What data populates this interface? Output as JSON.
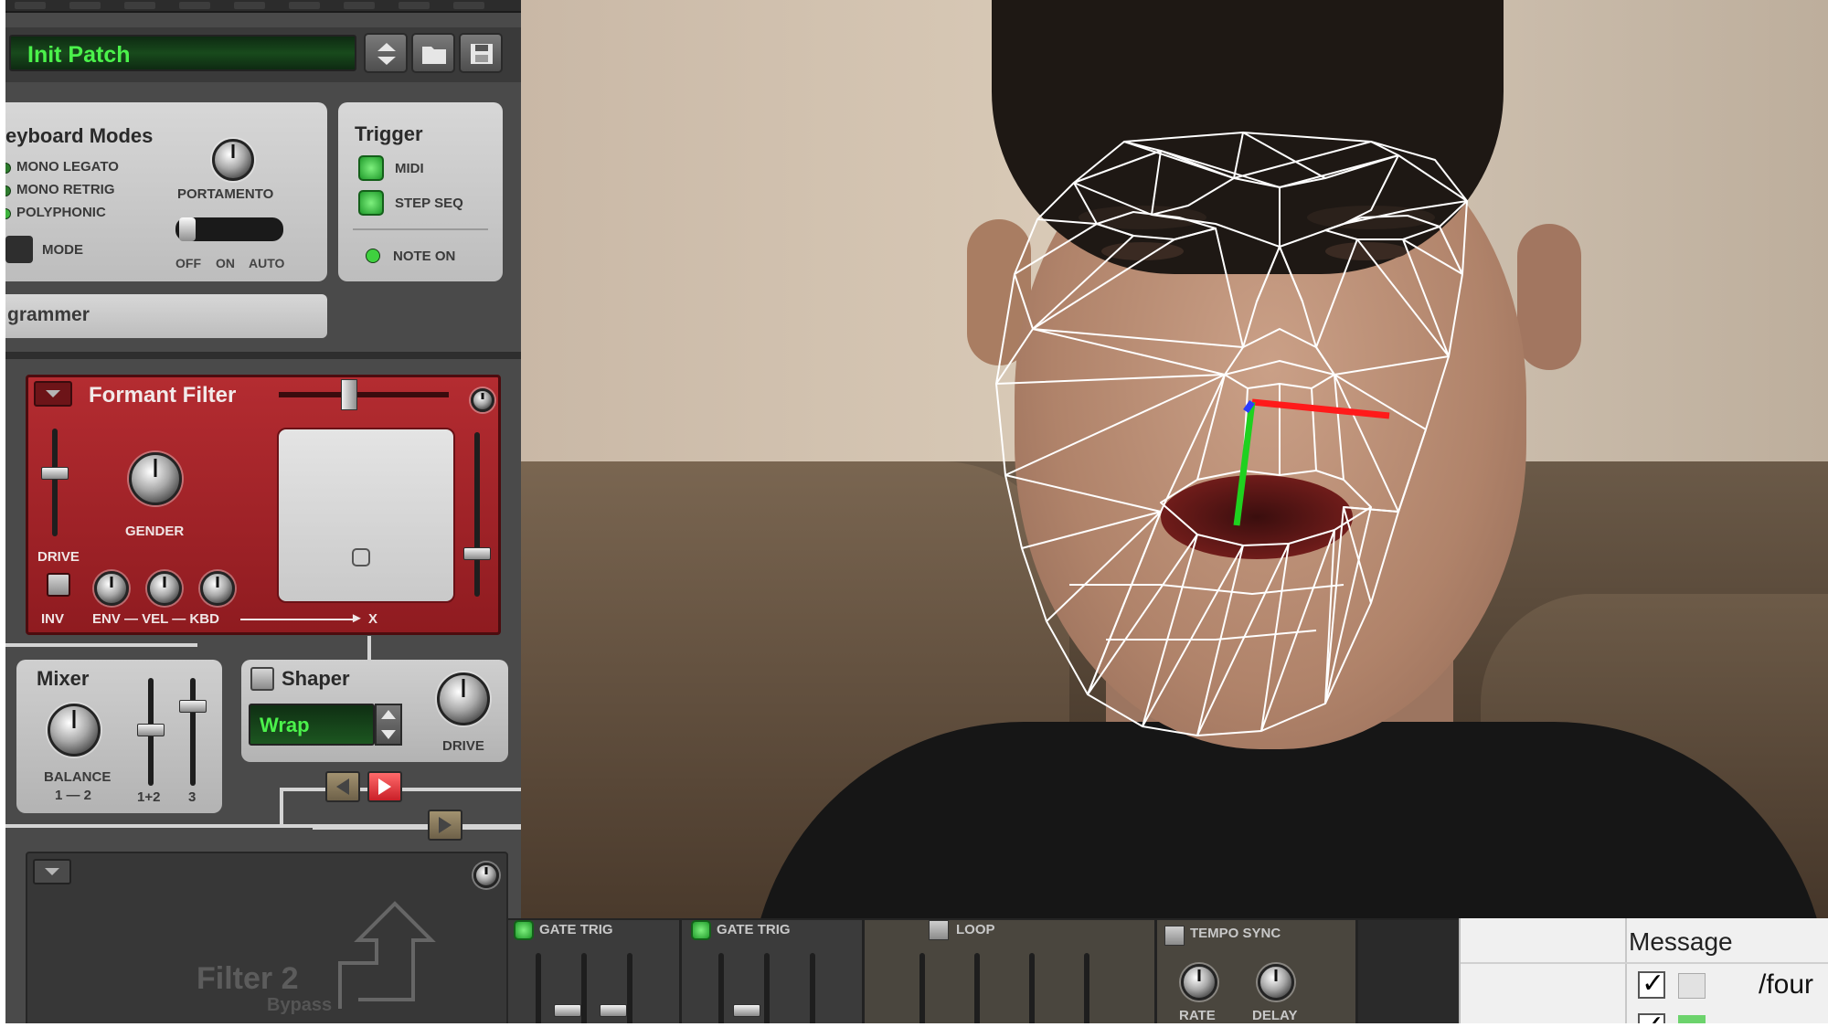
{
  "rack": {
    "patch_name": "Init Patch",
    "keyboard_modes": {
      "title": "eyboard Modes",
      "options": [
        "MONO LEGATO",
        "MONO RETRIG",
        "POLYPHONIC"
      ],
      "mode_label": "MODE",
      "portamento_label": "PORTAMENTO",
      "portamento_switch": [
        "OFF",
        "ON",
        "AUTO"
      ]
    },
    "trigger": {
      "title": "Trigger",
      "midi_label": "MIDI",
      "step_seq_label": "STEP SEQ",
      "note_on_label": "NOTE ON"
    },
    "programmer_label": "grammer",
    "formant_filter": {
      "title": "Formant Filter",
      "drive_label": "DRIVE",
      "gender_label": "GENDER",
      "inv_label": "INV",
      "env_vel_kbd_label": "ENV — VEL — KBD",
      "x_label": "X"
    },
    "mixer": {
      "title": "Mixer",
      "balance_label": "BALANCE",
      "balance_sub": "1 — 2",
      "fader_labels": [
        "1+2",
        "3"
      ]
    },
    "shaper": {
      "title": "Shaper",
      "mode_value": "Wrap",
      "drive_label": "DRIVE"
    },
    "filter2": {
      "title": "Filter 2",
      "state": "Bypass"
    }
  },
  "bottom_rack": {
    "gate_trig_1": "GATE TRIG",
    "gate_trig_2": "GATE TRIG",
    "loop": "LOOP",
    "tempo_sync": "TEMPO SYNC",
    "rate": "RATE",
    "delay": "DELAY"
  },
  "osc_window": {
    "column_header": "Message",
    "rows": [
      {
        "checked": true,
        "text": "/four"
      },
      {
        "checked": true,
        "text": ""
      }
    ]
  },
  "colors": {
    "lcd_text": "#4bf24b",
    "formant_red": "#b42c31",
    "mesh": "#ffffff",
    "axis_x": "#ff1a1a",
    "axis_y": "#1fd11f",
    "axis_z": "#2a3cff"
  }
}
